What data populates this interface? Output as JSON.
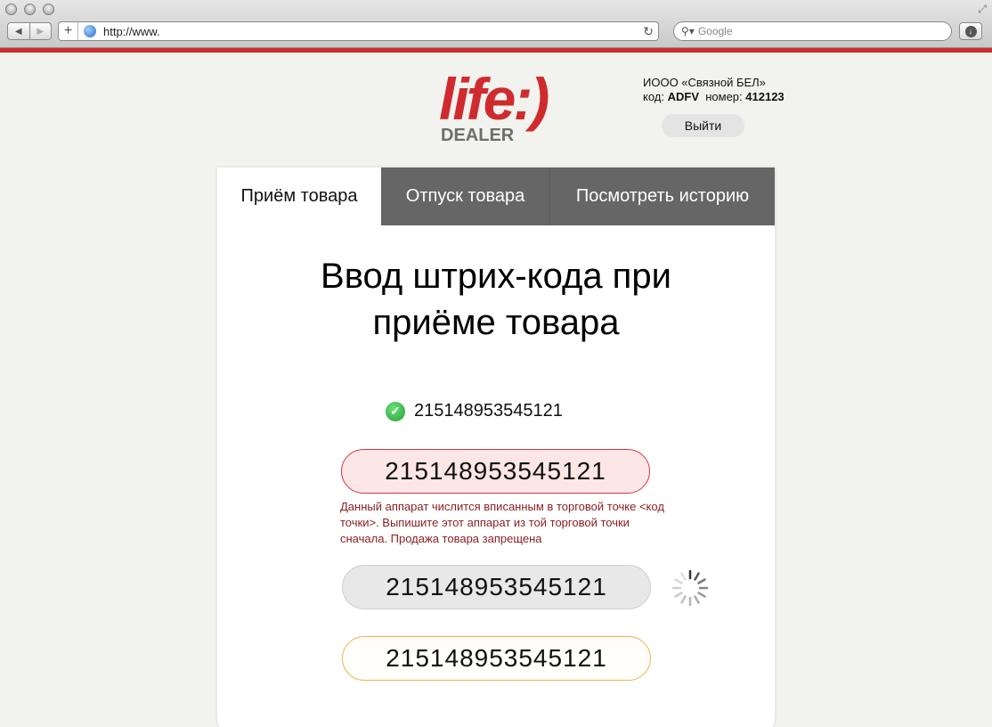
{
  "browser": {
    "url": "http://www.",
    "search_placeholder": "Google"
  },
  "brand": {
    "logo_word": "life:)",
    "logo_sub": "DEALER",
    "accent": "#cf2b2f"
  },
  "dealer": {
    "company": "ИООО «Связной БЕЛ»",
    "code_label": "код:",
    "code_value": "ADFV",
    "number_label": "номер:",
    "number_value": "412123",
    "logout_label": "Выйти"
  },
  "tabs": [
    {
      "label": "Приём товара",
      "active": true
    },
    {
      "label": "Отпуск товара",
      "active": false
    },
    {
      "label": "Посмотреть историю",
      "active": false
    }
  ],
  "main": {
    "heading_line1": "Ввод штрих-кода при",
    "heading_line2": "приёме товара",
    "scanned_code": "215148953545121",
    "fields": {
      "error_value": "215148953545121",
      "error_message": "Данный аппарат числится вписанным в торговой точке <код точки>. Выпишите этот аппарат из той торговой точки сначала. Продажа товара запрещена",
      "loading_value": "215148953545121",
      "warning_value": "215148953545121"
    }
  }
}
